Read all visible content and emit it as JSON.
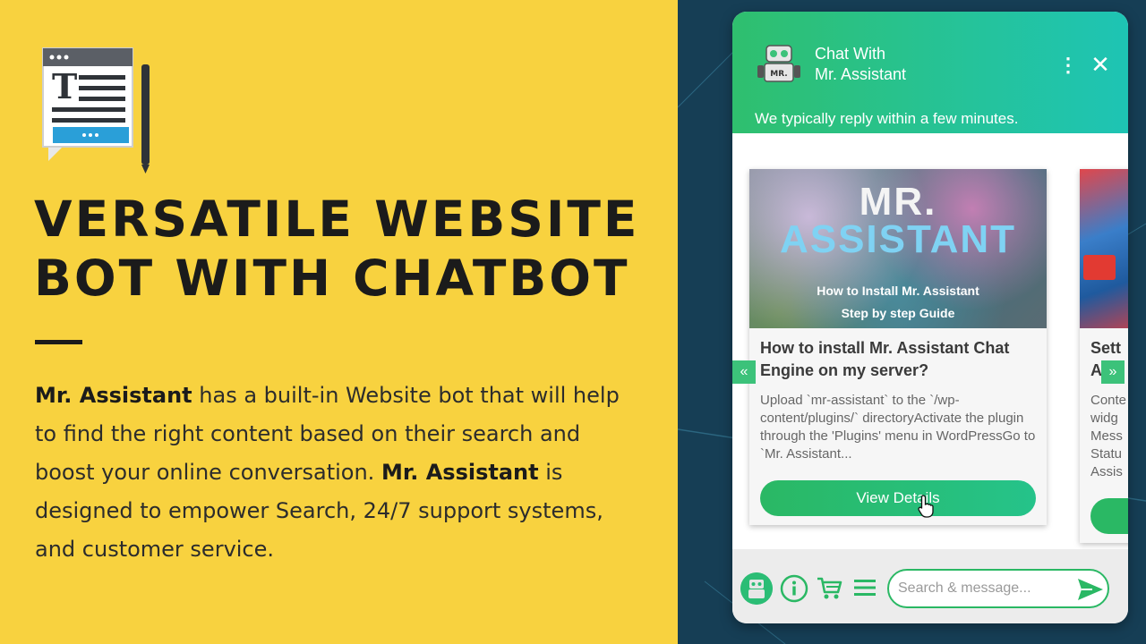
{
  "promo": {
    "headline_line1": "VERSATILE WEBSITE",
    "headline_line2": "BOT WITH CHATBOT",
    "desc_brand1": "Mr. Assistant",
    "desc_part1": " has a built-in Website bot that will help to find the right content based on their search and boost your online conversation. ",
    "desc_brand2": "Mr. Assistant",
    "desc_part2": " is designed to empower Search, 24/7 support systems, and customer service."
  },
  "chat": {
    "title_line1": "Chat With",
    "title_line2": "Mr. Assistant",
    "reply_note": "We typically reply within a few minutes.",
    "menu_glyph": "⋮",
    "close_glyph": "✕",
    "nav_prev_glyph": "«",
    "nav_next_glyph": "»",
    "cards": [
      {
        "image_title_1": "MR.",
        "image_title_2": "ASSISTANT",
        "image_caption_1": "How to Install Mr. Assistant",
        "image_caption_2": "Step by step Guide",
        "title": "How to install Mr. Assistant Chat Engine on my server?",
        "text": "Upload `mr-assistant` to the `/wp-content/plugins/` directoryActivate the plugin through the 'Plugins' menu in WordPressGo to `Mr. Assistant...",
        "button": "View Details"
      },
      {
        "title_partial": "Sett\nAs",
        "text_partial": "Conte\nwidg\nMess\nStatu\nAssis"
      }
    ],
    "search_placeholder": "Search & message...",
    "colors": {
      "accent": "#2ab864",
      "header_end": "#1ec4b4",
      "promo_bg": "#f8d23f",
      "page_bg": "#163e55"
    }
  }
}
